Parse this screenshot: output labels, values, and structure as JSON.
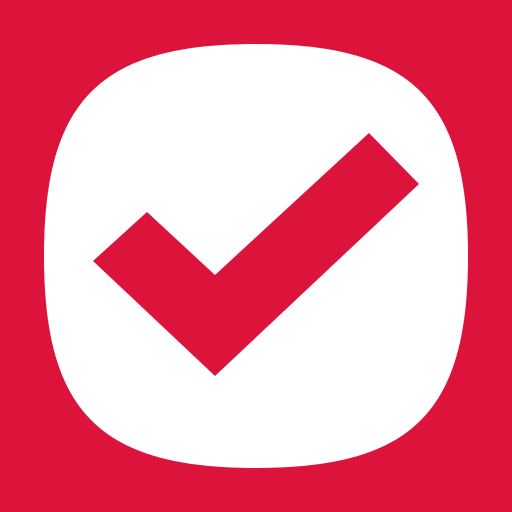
{
  "icon": {
    "name": "checkmark-icon",
    "background_color": "#DC143C",
    "badge_color": "#FFFFFF",
    "check_color": "#DC143C"
  }
}
